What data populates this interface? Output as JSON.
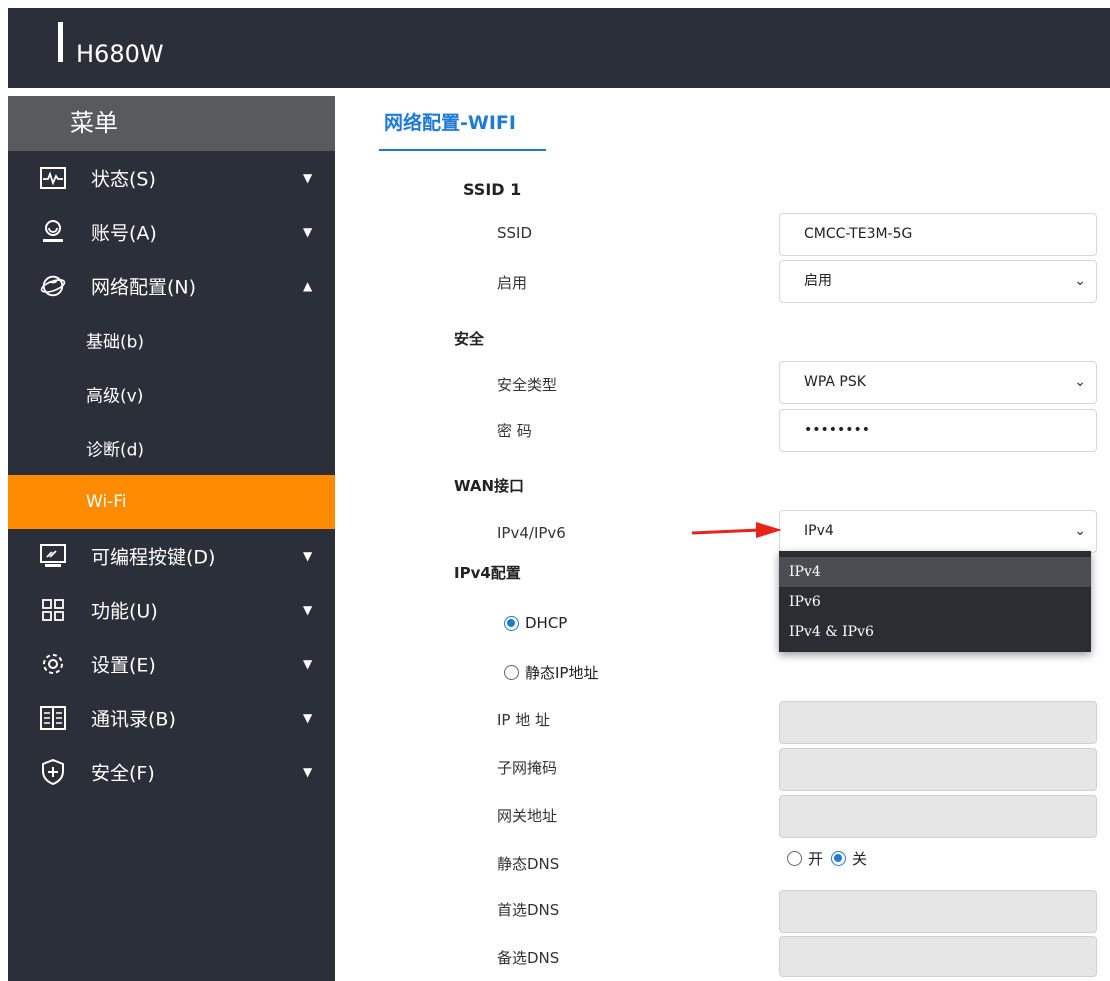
{
  "app": {
    "brand": "H680W"
  },
  "sidebar": {
    "header": "菜单",
    "items": [
      {
        "label": "状态(S)",
        "icon": "status-monitor-icon",
        "arrow": "▼"
      },
      {
        "label": "账号(A)",
        "icon": "account-icon",
        "arrow": "▼"
      },
      {
        "label": "网络配置(N)",
        "icon": "network-globe-icon",
        "arrow": "▲"
      }
    ],
    "subitems": [
      {
        "label": "基础(b)"
      },
      {
        "label": "高级(v)"
      },
      {
        "label": "诊断(d)"
      },
      {
        "label": "Wi-Fi",
        "active": true
      }
    ],
    "items2": [
      {
        "label": "可编程按键(D)",
        "icon": "programmable-key-icon",
        "arrow": "▼"
      },
      {
        "label": "功能(U)",
        "icon": "function-grid-icon",
        "arrow": "▼"
      },
      {
        "label": "设置(E)",
        "icon": "settings-gear-icon",
        "arrow": "▼"
      },
      {
        "label": "通讯录(B)",
        "icon": "phonebook-icon",
        "arrow": "▼"
      },
      {
        "label": "安全(F)",
        "icon": "security-shield-icon",
        "arrow": "▼"
      }
    ]
  },
  "page": {
    "title": "网络配置-WIFI",
    "ssid_section": "SSID 1",
    "ssid_label": "SSID",
    "ssid_value": "CMCC-TE3M-5G",
    "enable_label": "启用",
    "enable_value": "启用",
    "security_section": "安全",
    "security_type_label": "安全类型",
    "security_type_value": "WPA PSK",
    "password_label": "密 码",
    "password_value": "••••••••",
    "wan_section": "WAN接口",
    "ipmode_label": "IPv4/IPv6",
    "ipmode_value": "IPv4",
    "ipmode_options": [
      "IPv4",
      "IPv6",
      "IPv4 & IPv6"
    ],
    "ipv4_section": "IPv4配置",
    "dhcp_label": "DHCP",
    "static_ip_label": "静态IP地址",
    "ip_label": "IP 地 址",
    "subnet_label": "子网掩码",
    "gateway_label": "网关地址",
    "static_dns_label": "静态DNS",
    "dns_on_label": "开",
    "dns_off_label": "关",
    "primary_dns_label": "首选DNS",
    "secondary_dns_label": "备选DNS"
  },
  "colors": {
    "accent": "#1f7ad6",
    "active": "#ff8c00",
    "sidebar": "#2b2f3a",
    "arrow": "#e8231a"
  }
}
